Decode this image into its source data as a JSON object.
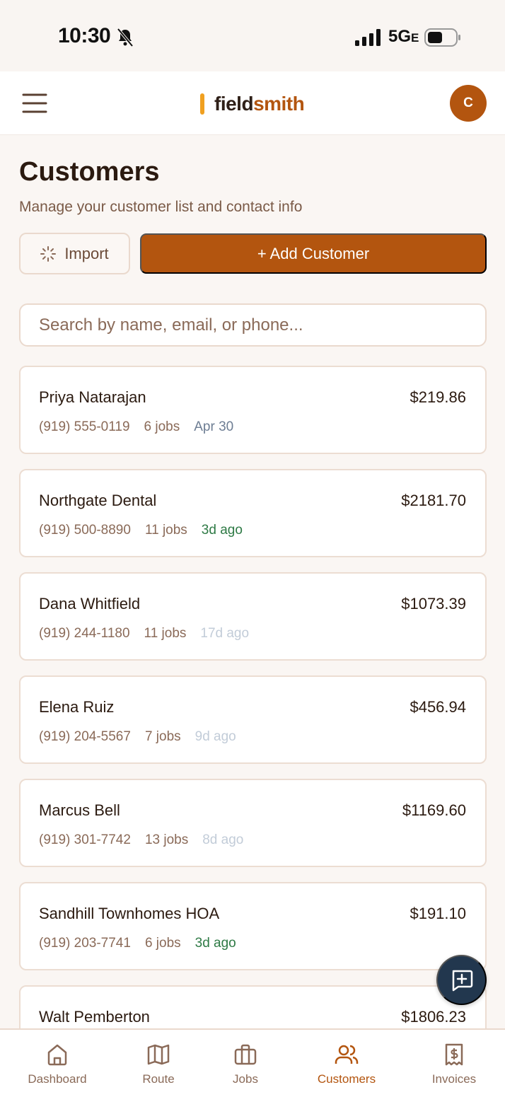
{
  "status_bar": {
    "time": "10:30",
    "network": "5G",
    "network_suffix": "E",
    "icons": [
      "bell-slash-icon",
      "signal-bars-icon",
      "battery-icon"
    ]
  },
  "header": {
    "logo_part1": "field",
    "logo_part2": "smith",
    "avatar_initial": "C",
    "menu_icon": "hamburger-menu-icon"
  },
  "page": {
    "title": "Customers",
    "subtitle": "Manage your customer list and contact info",
    "import_label": "Import",
    "add_label": "+ Add Customer",
    "search_placeholder": "Search by name, email, or phone..."
  },
  "customers": [
    {
      "name": "Priya Natarajan",
      "amount": "$219.86",
      "phone": "(919) 555-0119",
      "jobs": "6 jobs",
      "recency": "Apr 30",
      "recency_status": "neutral"
    },
    {
      "name": "Northgate Dental",
      "amount": "$2181.70",
      "phone": "(919) 500-8890",
      "jobs": "11 jobs",
      "recency": "3d ago",
      "recency_status": "recent"
    },
    {
      "name": "Dana Whitfield",
      "amount": "$1073.39",
      "phone": "(919) 244-1180",
      "jobs": "11 jobs",
      "recency": "17d ago",
      "recency_status": "stale"
    },
    {
      "name": "Elena Ruiz",
      "amount": "$456.94",
      "phone": "(919) 204-5567",
      "jobs": "7 jobs",
      "recency": "9d ago",
      "recency_status": "stale"
    },
    {
      "name": "Marcus Bell",
      "amount": "$1169.60",
      "phone": "(919) 301-7742",
      "jobs": "13 jobs",
      "recency": "8d ago",
      "recency_status": "stale"
    },
    {
      "name": "Sandhill Townhomes HOA",
      "amount": "$191.10",
      "phone": "(919) 203-7741",
      "jobs": "6 jobs",
      "recency": "3d ago",
      "recency_status": "recent"
    },
    {
      "name": "Walt Pemberton",
      "amount": "$1806.23",
      "phone": "",
      "jobs": "",
      "recency": "",
      "recency_status": "neutral"
    }
  ],
  "bottom_nav": [
    {
      "label": "Dashboard",
      "icon": "home-icon",
      "active": false
    },
    {
      "label": "Route",
      "icon": "map-icon",
      "active": false
    },
    {
      "label": "Jobs",
      "icon": "briefcase-icon",
      "active": false
    },
    {
      "label": "Customers",
      "icon": "users-icon",
      "active": true
    },
    {
      "label": "Invoices",
      "icon": "invoice-icon",
      "active": false
    }
  ],
  "colors": {
    "accent": "#b3550f",
    "logo_bar": "#f0a020",
    "fab": "#22374e",
    "recent": "#2e7a45",
    "stale": "#c2ccd8",
    "neutral_date": "#6d7d93"
  },
  "fab_icon": "message-plus-icon"
}
